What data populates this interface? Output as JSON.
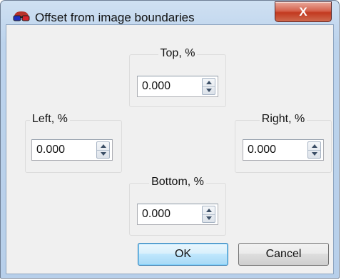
{
  "window": {
    "title": "Offset from image boundaries",
    "close_glyph": "X",
    "icon": "3d-glasses-icon"
  },
  "fields": {
    "top": {
      "label": "Top, %",
      "value": "0.000"
    },
    "left": {
      "label": "Left, %",
      "value": "0.000"
    },
    "right": {
      "label": "Right, %",
      "value": "0.000"
    },
    "bottom": {
      "label": "Bottom, %",
      "value": "0.000"
    }
  },
  "buttons": {
    "ok": "OK",
    "cancel": "Cancel"
  },
  "colors": {
    "close_button": "#c2391f",
    "default_button_border": "#3c7fb1",
    "client_background": "#f0f0f0"
  }
}
